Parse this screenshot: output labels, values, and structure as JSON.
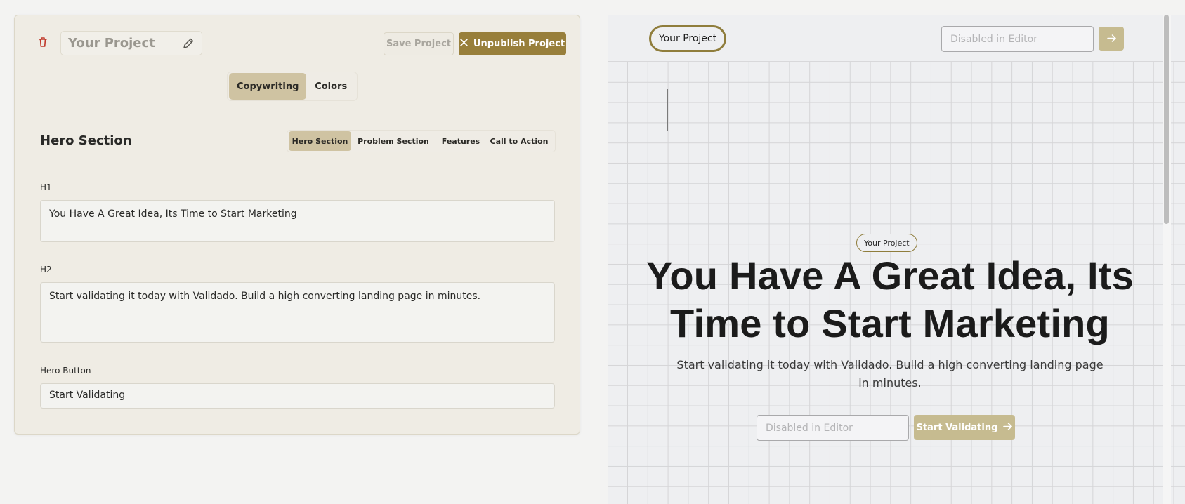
{
  "editor": {
    "project_name": "Your Project",
    "save_label": "Save Project",
    "unpublish_label": "Unpublish Project",
    "tabs": [
      {
        "label": "Copywriting",
        "active": true
      },
      {
        "label": "Colors",
        "active": false
      }
    ],
    "section_title": "Hero Section",
    "sub_tabs": [
      {
        "label": "Hero Section",
        "active": true
      },
      {
        "label": "Problem Section",
        "active": false
      },
      {
        "label": "Features",
        "active": false
      },
      {
        "label": "Call to Action",
        "active": false
      }
    ],
    "fields": {
      "h1_label": "H1",
      "h1_value": "You Have A Great Idea, Its Time to Start Marketing",
      "h2_label": "H2",
      "h2_value": "Start validating it today with Validado. Build a high converting landing page in minutes.",
      "button_label": "Hero Button",
      "button_value": "Start Validating"
    },
    "icons": {
      "trash": "trash-icon",
      "pencil": "pencil-icon",
      "close": "close-icon"
    }
  },
  "preview": {
    "brand": "Your Project",
    "header_input_placeholder": "Disabled in Editor",
    "badge": "Your Project",
    "headline": "You Have A Great Idea, Its Time to Start Marketing",
    "subheadline": "Start validating it today with Validado. Build a high converting landing page in minutes.",
    "input_placeholder": "Disabled in Editor",
    "cta_label": "Start Validating",
    "icons": {
      "arrow": "arrow-right-icon"
    }
  },
  "colors": {
    "accent": "#987f3b",
    "accent_light": "#c6bb90",
    "tab_active": "#cfc3a2",
    "danger": "#c0392b"
  }
}
